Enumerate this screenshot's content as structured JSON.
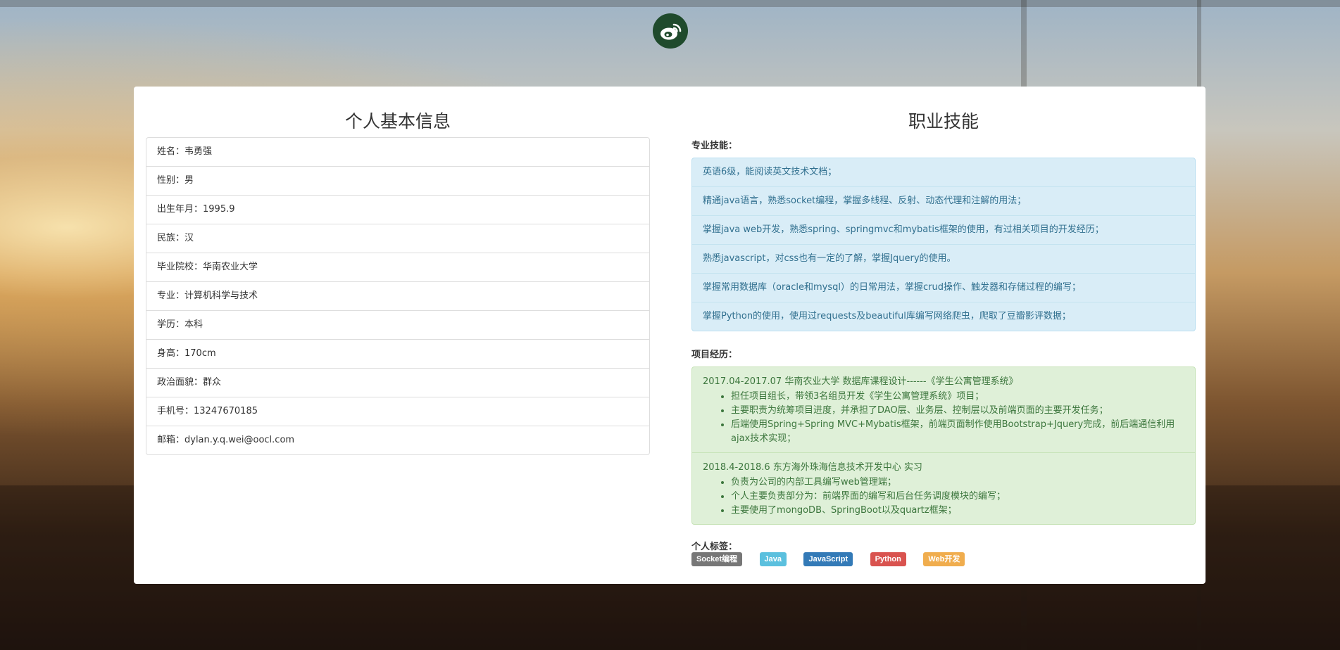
{
  "logo": {
    "icon": "weibo-icon",
    "color": "#1f4a2c"
  },
  "left": {
    "title": "个人基本信息",
    "items": [
      "姓名：韦勇强",
      "性别：男",
      "出生年月：1995.9",
      "民族：汉",
      "毕业院校：华南农业大学",
      "专业：计算机科学与技术",
      "学历：本科",
      "身高：170cm",
      "政治面貌：群众",
      "手机号：13247670185",
      "邮箱：dylan.y.q.wei@oocl.com"
    ]
  },
  "right": {
    "title": "职业技能",
    "skills_label": "专业技能：",
    "skills": [
      "英语6级，能阅读英文技术文档；",
      "精通java语言，熟悉socket编程，掌握多线程、反射、动态代理和注解的用法；",
      "掌握java web开发，熟悉spring、springmvc和mybatis框架的使用，有过相关项目的开发经历；",
      "熟悉javascript，对css也有一定的了解，掌握Jquery的使用。",
      "掌握常用数据库（oracle和mysql）的日常用法，掌握crud操作、触发器和存储过程的编写；",
      "掌握Python的使用，使用过requests及beautiful库编写网络爬虫，爬取了豆瓣影评数据；"
    ],
    "projects_label": "项目经历：",
    "projects": [
      {
        "title": "2017.04-2017.07 华南农业大学 数据库课程设计------《学生公寓管理系统》",
        "bullets": [
          "担任项目组长，带领3名组员开发《学生公寓管理系统》项目；",
          "主要职责为统筹项目进度，并承担了DAO层、业务层、控制层以及前端页面的主要开发任务；",
          "后端使用Spring+Spring MVC+Mybatis框架，前端页面制作使用Bootstrap+Jquery完成，前后端通信利用ajax技术实现；"
        ]
      },
      {
        "title": "2018.4-2018.6 东方海外珠海信息技术开发中心 实习",
        "bullets": [
          "负责为公司的内部工具编写web管理端；",
          "个人主要负责部分为：前端界面的编写和后台任务调度模块的编写；",
          "主要使用了mongoDB、SpringBoot以及quartz框架；"
        ]
      }
    ],
    "tags_label": "个人标签：",
    "tags": [
      {
        "label": "Socket编程",
        "color": "#777777"
      },
      {
        "label": "Java",
        "color": "#5bc0de"
      },
      {
        "label": "JavaScript",
        "color": "#337ab7"
      },
      {
        "label": "Python",
        "color": "#d9534f"
      },
      {
        "label": "Web开发",
        "color": "#f0ad4e"
      }
    ]
  }
}
